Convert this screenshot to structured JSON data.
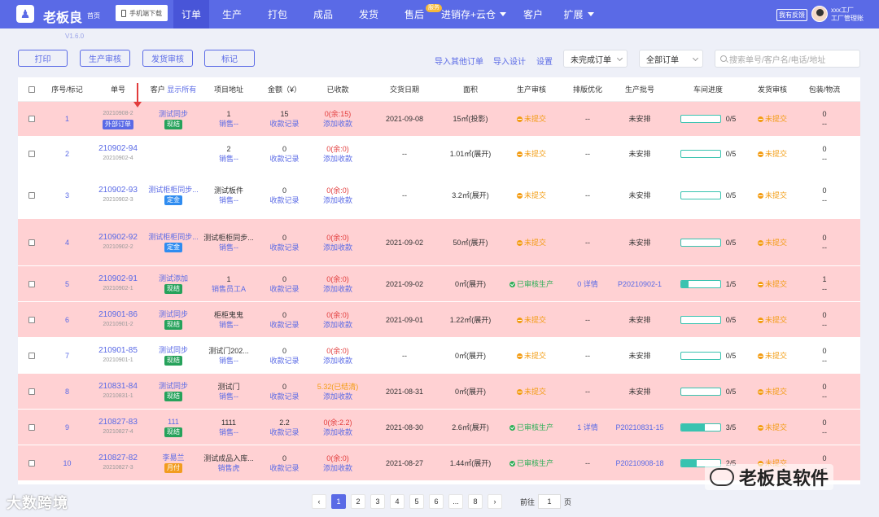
{
  "app": {
    "title": "老板良",
    "home": "首页",
    "version": "V1.6.0",
    "mobile_label": "手机端下载"
  },
  "nav": [
    {
      "label": "订单",
      "active": true
    },
    {
      "label": "生产"
    },
    {
      "label": "打包"
    },
    {
      "label": "成品"
    },
    {
      "label": "发货"
    },
    {
      "label": "售后",
      "badge": "服务"
    },
    {
      "label": "进销存+云仓",
      "dropdown": true
    },
    {
      "label": "客户"
    },
    {
      "label": "扩展",
      "dropdown": true
    }
  ],
  "user": {
    "feedback": "我有反馈",
    "name": "xxx工厂",
    "role": "工厂管理账"
  },
  "toolbar": {
    "print": "打印",
    "prod_review": "生产审核",
    "ship_review": "发货审核",
    "mark": "标记",
    "import_other": "导入其他订单",
    "import_design": "导入设计",
    "settings": "设置",
    "status_filter": "未完成订单",
    "order_filter": "全部订单",
    "search_placeholder": "搜索单号/客户名/电话/地址"
  },
  "columns": {
    "seq": "序号/标记",
    "order_no": "单号",
    "customer": "客户",
    "show_all": "显示所有",
    "address": "项目地址",
    "amount": "金额（¥）",
    "received": "已收款",
    "date": "交货日期",
    "area": "面积",
    "prod_review": "生产审核",
    "layout": "排版优化",
    "batch": "生产批号",
    "progress": "车间进度",
    "ship_review": "发货审核",
    "pack": "包装/物流"
  },
  "rows": [
    {
      "seq": "1",
      "order_no": "",
      "sub_no": "20210908-2",
      "tag": "外部订单",
      "tag_color": "purple",
      "customer": "测试同步",
      "cust_tag": "现结",
      "cust_tag_color": "green",
      "addr": "1",
      "addr_sub": "销售--",
      "amount": "15",
      "amount_sub": "收款记录",
      "received": "0(余:15)",
      "received_sub": "添加收款",
      "date": "2021-09-08",
      "area": "15㎡(投影)",
      "prod": "未提交",
      "prod_state": "o",
      "layout": "--",
      "batch": "未安排",
      "prog_text": "0/5",
      "progress": 0,
      "ship": "未提交",
      "pack": "0",
      "pack_sub": "--",
      "color": "pink"
    },
    {
      "seq": "2",
      "order_no": "210902-94",
      "sub_no": "20210902-4",
      "tag": "",
      "customer": "",
      "cust_tag": "",
      "addr": "2",
      "addr_sub": "销售--",
      "amount": "0",
      "amount_sub": "收款记录",
      "received": "0(余:0)",
      "received_sub": "添加收款",
      "date": "--",
      "area": "1.01㎡(展开)",
      "prod": "未提交",
      "prod_state": "o",
      "layout": "--",
      "batch": "未安排",
      "prog_text": "0/5",
      "progress": 0,
      "ship": "未提交",
      "pack": "0",
      "pack_sub": "--",
      "color": "white"
    },
    {
      "seq": "3",
      "order_no": "210902-93",
      "sub_no": "20210902-3",
      "tag": "",
      "customer": "测试柜柜同步...",
      "cust_tag": "定金",
      "cust_tag_color": "blue",
      "addr": "测试板件",
      "addr_sub": "销售--",
      "amount": "0",
      "amount_sub": "收款记录",
      "received": "0(余:0)",
      "received_sub": "添加收款",
      "date": "--",
      "area": "3.2㎡(展开)",
      "prod": "未提交",
      "prod_state": "o",
      "layout": "--",
      "batch": "未安排",
      "prog_text": "0/5",
      "progress": 0,
      "ship": "未提交",
      "pack": "0",
      "pack_sub": "--",
      "color": "white"
    },
    {
      "seq": "4",
      "order_no": "210902-92",
      "sub_no": "20210902-2",
      "tag": "",
      "customer": "测试柜柜同步...",
      "cust_tag": "定金",
      "cust_tag_color": "blue",
      "addr": "测试柜柜同步...",
      "addr_sub": "销售--",
      "amount": "0",
      "amount_sub": "收款记录",
      "received": "0(余:0)",
      "received_sub": "添加收款",
      "date": "2021-09-02",
      "area": "50㎡(展开)",
      "prod": "未提交",
      "prod_state": "o",
      "layout": "--",
      "batch": "未安排",
      "prog_text": "0/5",
      "progress": 0,
      "ship": "未提交",
      "pack": "0",
      "pack_sub": "--",
      "color": "pink"
    },
    {
      "seq": "5",
      "order_no": "210902-91",
      "sub_no": "20210902-1",
      "tag": "",
      "customer": "测试添加",
      "cust_tag": "现结",
      "cust_tag_color": "green",
      "addr": "1",
      "addr_sub": "销售员工A",
      "amount": "0",
      "amount_sub": "收款记录",
      "received": "0(余:0)",
      "received_sub": "添加收款",
      "date": "2021-09-02",
      "area": "0㎡(展开)",
      "prod": "已审核生产",
      "prod_state": "g",
      "layout": "0 详情",
      "batch": "P20210902-1",
      "prog_text": "1/5",
      "progress": 0.2,
      "ship": "未提交",
      "pack": "1",
      "pack_sub": "--",
      "color": "pink"
    },
    {
      "seq": "6",
      "order_no": "210901-86",
      "sub_no": "20210901-2",
      "tag": "",
      "customer": "测试同步",
      "cust_tag": "现结",
      "cust_tag_color": "green",
      "addr": "柜柜鬼鬼",
      "addr_sub": "销售--",
      "amount": "0",
      "amount_sub": "收款记录",
      "received": "0(余:0)",
      "received_sub": "添加收款",
      "date": "2021-09-01",
      "area": "1.22㎡(展开)",
      "prod": "未提交",
      "prod_state": "o",
      "layout": "--",
      "batch": "未安排",
      "prog_text": "0/5",
      "progress": 0,
      "ship": "未提交",
      "pack": "0",
      "pack_sub": "--",
      "color": "pink"
    },
    {
      "seq": "7",
      "order_no": "210901-85",
      "sub_no": "20210901-1",
      "tag": "",
      "customer": "测试同步",
      "cust_tag": "现结",
      "cust_tag_color": "green",
      "addr": "测试门202...",
      "addr_sub": "销售--",
      "amount": "0",
      "amount_sub": "收款记录",
      "received": "0(余:0)",
      "received_sub": "添加收款",
      "date": "--",
      "area": "0㎡(展开)",
      "prod": "未提交",
      "prod_state": "o",
      "layout": "--",
      "batch": "未安排",
      "prog_text": "0/5",
      "progress": 0,
      "ship": "未提交",
      "pack": "0",
      "pack_sub": "--",
      "color": "white"
    },
    {
      "seq": "8",
      "order_no": "210831-84",
      "sub_no": "20210831-1",
      "tag": "",
      "customer": "测试同步",
      "cust_tag": "现结",
      "cust_tag_color": "green",
      "addr": "测试门",
      "addr_sub": "销售--",
      "amount": "0",
      "amount_sub": "收款记录",
      "received": "5.32(已结清)",
      "received_ok": true,
      "received_sub": "添加收款",
      "date": "2021-08-31",
      "area": "0㎡(展开)",
      "prod": "未提交",
      "prod_state": "o",
      "layout": "--",
      "batch": "未安排",
      "prog_text": "0/5",
      "progress": 0,
      "ship": "未提交",
      "pack": "0",
      "pack_sub": "--",
      "color": "pink"
    },
    {
      "seq": "9",
      "order_no": "210827-83",
      "sub_no": "20210827-4",
      "tag": "",
      "customer": "111",
      "cust_tag": "现结",
      "cust_tag_color": "green",
      "addr": "1111",
      "addr_sub": "销售--",
      "amount": "2.2",
      "amount_sub": "收款记录",
      "received": "0(余:2.2)",
      "received_sub": "添加收款",
      "date": "2021-08-30",
      "area": "2.6㎡(展开)",
      "prod": "已审核生产",
      "prod_state": "g",
      "layout": "1 详情",
      "batch": "P20210831-15",
      "prog_text": "3/5",
      "progress": 0.6,
      "ship": "未提交",
      "pack": "0",
      "pack_sub": "--",
      "color": "pink"
    },
    {
      "seq": "10",
      "order_no": "210827-82",
      "sub_no": "20210827-3",
      "tag": "",
      "customer": "李易兰",
      "cust_tag": "月付",
      "cust_tag_color": "orange",
      "addr": "测试成品入库...",
      "addr_sub": "销售虎",
      "amount": "0",
      "amount_sub": "收款记录",
      "received": "0(余:0)",
      "received_sub": "添加收款",
      "date": "2021-08-27",
      "area": "1.44㎡(展开)",
      "prod": "已审核生产",
      "prod_state": "g",
      "layout": "--",
      "batch": "P20210908-18",
      "prog_text": "2/5",
      "progress": 0.4,
      "ship": "未提交",
      "pack": "0",
      "pack_sub": "--",
      "color": "pink"
    }
  ],
  "pagination": {
    "prev": "‹",
    "pages": [
      "1",
      "2",
      "3",
      "4",
      "5",
      "6",
      "...",
      "8"
    ],
    "current": "1",
    "next": "›",
    "goto_label": "前往",
    "goto_value": "1",
    "page_unit": "页"
  },
  "watermarks": {
    "left": "大数跨境",
    "right": "老板良软件"
  },
  "colors": {
    "primary": "#5a6ae6",
    "row_pink": "#ffd1d3",
    "pending": "#f39c12",
    "approved": "#2eae57",
    "progress": "#39c3b0"
  }
}
